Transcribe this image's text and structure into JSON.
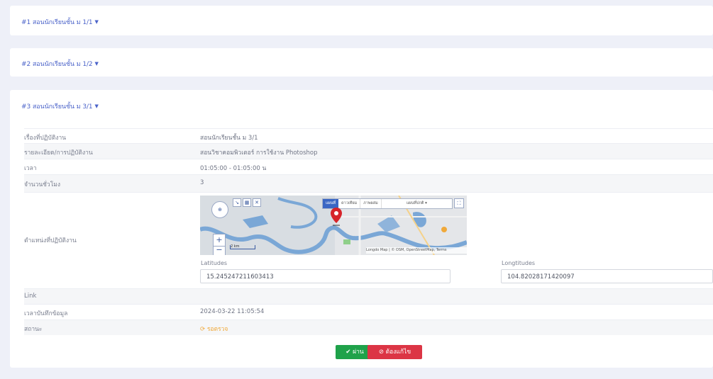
{
  "panels": [
    {
      "title": "#1 สอนนักเรียนชั้น ม 1/1"
    },
    {
      "title": "#2 สอนนักเรียนชั้น ม 1/2"
    },
    {
      "title": "#3 สอนนักเรียนชั้น ม 3/1"
    }
  ],
  "details": {
    "topic": {
      "label": "เรื่องที่ปฏิบัติงาน",
      "value": "สอนนักเรียนชั้น ม 3/1"
    },
    "description": {
      "label": "รายละเอียด/การปฏิบัติงาน",
      "value": "สอนวิชาคอมพิวเตอร์ การใช้งาน Photoshop"
    },
    "time": {
      "label": "เวลา",
      "value": "01:05:00 - 01:05:00 น"
    },
    "hours": {
      "label": "จำนวนชั่วโมง",
      "value": "3"
    },
    "location": {
      "label": "ตำแหน่งที่ปฏิบัติงาน"
    },
    "link": {
      "label": "Link",
      "value": ""
    },
    "saved_at": {
      "label": "เวลาบันทึกข้อมูล",
      "value": "2024-03-22 11:05:54"
    },
    "status": {
      "label": "สถานะ",
      "value": "รอตรวจ"
    }
  },
  "coords": {
    "lat_label": "Latitudes",
    "lat_value": "15.245247211603413",
    "lng_label": "Longtitudes",
    "lng_value": "104.82028171420097"
  },
  "map": {
    "type_options": [
      "แผนที่",
      "ดาวเทียม",
      "ภาพผสม"
    ],
    "dropdown_value": "แผนที่ปกติ",
    "attribution": "Longdo Map | © OSM, OpenStreetMap, Terms",
    "scale_label": "2 km"
  },
  "actions": {
    "approve_label": "ผ่าน",
    "fix_label": "ต้องแก้ไข"
  },
  "colors": {
    "accent": "#4b63c9",
    "approve": "#1fa24a",
    "reject": "#dc3545",
    "pending": "#f0a93a"
  }
}
